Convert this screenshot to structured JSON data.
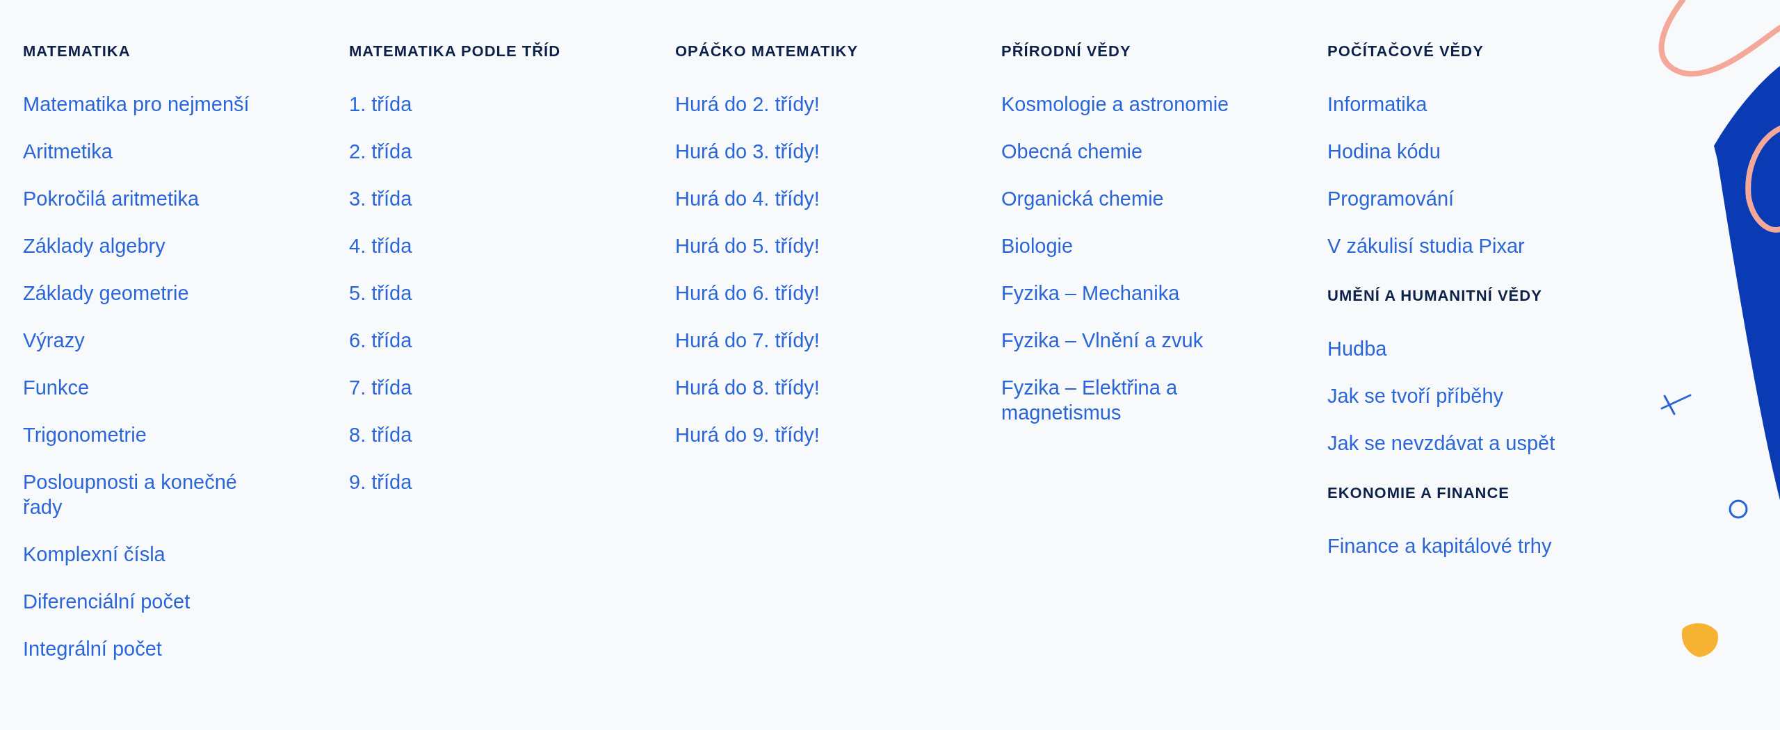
{
  "columns": [
    {
      "sections": [
        {
          "heading": "MATEMATIKA",
          "links": [
            "Matematika pro nejmenší",
            "Aritmetika",
            "Pokročilá aritmetika",
            "Základy algebry",
            "Základy geometrie",
            "Výrazy",
            "Funkce",
            "Trigonometrie",
            "Posloupnosti a konečné řady",
            "Komplexní čísla",
            "Diferenciální počet",
            "Integrální počet"
          ]
        }
      ]
    },
    {
      "sections": [
        {
          "heading": "MATEMATIKA PODLE TŘÍD",
          "links": [
            "1. třída",
            "2. třída",
            "3. třída",
            "4. třída",
            "5. třída",
            "6. třída",
            "7. třída",
            "8. třída",
            "9. třída"
          ]
        }
      ]
    },
    {
      "sections": [
        {
          "heading": "OPÁČKO MATEMATIKY",
          "links": [
            "Hurá do 2. třídy!",
            "Hurá do 3. třídy!",
            "Hurá do 4. třídy!",
            "Hurá do 5. třídy!",
            "Hurá do 6. třídy!",
            "Hurá do 7. třídy!",
            "Hurá do 8. třídy!",
            "Hurá do 9. třídy!"
          ]
        }
      ]
    },
    {
      "sections": [
        {
          "heading": "PŘÍRODNÍ VĚDY",
          "links": [
            "Kosmologie a astronomie",
            "Obecná chemie",
            "Organická chemie",
            "Biologie",
            "Fyzika – Mechanika",
            "Fyzika – Vlnění a zvuk",
            "Fyzika – Elektřina a magnetismus"
          ]
        }
      ]
    },
    {
      "sections": [
        {
          "heading": "POČÍTAČOVÉ VĚDY",
          "links": [
            "Informatika",
            "Hodina kódu",
            "Programování",
            "V zákulisí studia Pixar"
          ]
        },
        {
          "heading": "UMĚNÍ A HUMANITNÍ VĚDY",
          "links": [
            "Hudba",
            "Jak se tvoří příběhy",
            "Jak se nevzdávat a uspět"
          ]
        },
        {
          "heading": "EKONOMIE A FINANCE",
          "links": [
            "Finance a kapitálové trhy"
          ]
        }
      ]
    }
  ]
}
